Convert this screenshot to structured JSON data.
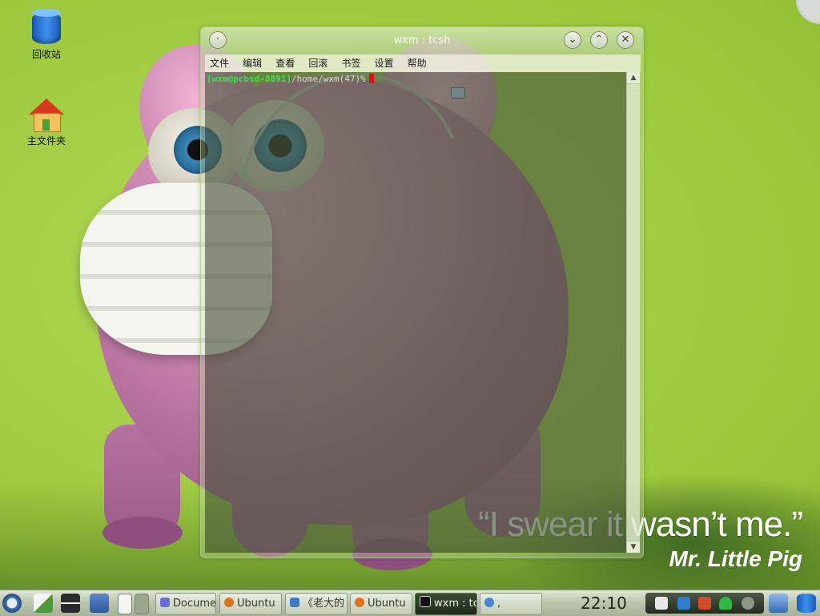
{
  "desktop": {
    "icons": [
      {
        "label": "回收站"
      },
      {
        "label": "主文件夹"
      }
    ],
    "wallpaper": {
      "quote": "“I swear it wasn’t me.”",
      "author": "Mr. Little Pig"
    }
  },
  "window": {
    "title": "wxm : tcsh",
    "buttons": {
      "minimize": "⌄",
      "maximize": "⌃",
      "close": "✕",
      "menu": "·"
    },
    "menu": [
      "文件",
      "编辑",
      "查看",
      "回滚",
      "书签",
      "设置",
      "帮助"
    ],
    "terminal": {
      "user_host": "[wxm@pcbsd-8891]",
      "path": "/home/wxm(47)%"
    }
  },
  "taskbar": {
    "tasks": [
      {
        "label": "Docume",
        "icon": "cube-icon"
      },
      {
        "label": "Ubuntu",
        "icon": "ubuntu-icon"
      },
      {
        "label": "《老大的",
        "icon": "folder-icon"
      },
      {
        "label": "Ubuntu",
        "icon": "ubuntu-icon"
      },
      {
        "label": "wxm : tc",
        "icon": "terminal-icon"
      },
      {
        "label": ",",
        "icon": "chat-icon"
      }
    ],
    "clock": "22:10"
  },
  "colors": {
    "prompt_green": "#3fe04a",
    "cursor_red": "#e01010",
    "wallpaper_green": "#a4cf46"
  }
}
